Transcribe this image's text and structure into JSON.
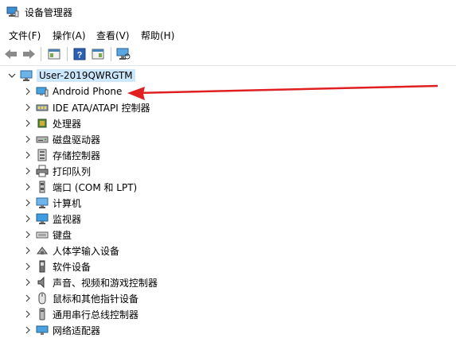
{
  "window": {
    "title": "设备管理器"
  },
  "menu": [
    "文件(F)",
    "操作(A)",
    "查看(V)",
    "帮助(H)"
  ],
  "toolbar": {
    "buttons": [
      "back-icon",
      "forward-icon",
      "properties-view-icon",
      "help-icon",
      "console-view-icon",
      "scan-hardware-icon"
    ]
  },
  "tree": {
    "root": "User-2019QWRGTM",
    "items": [
      {
        "label": "Android Phone",
        "icon": "android-phone-icon"
      },
      {
        "label": "IDE ATA/ATAPI 控制器",
        "icon": "ide-controller-icon"
      },
      {
        "label": "处理器",
        "icon": "processor-icon"
      },
      {
        "label": "磁盘驱动器",
        "icon": "disk-drive-icon"
      },
      {
        "label": "存储控制器",
        "icon": "storage-controller-icon"
      },
      {
        "label": "打印队列",
        "icon": "printer-icon"
      },
      {
        "label": "端口 (COM 和 LPT)",
        "icon": "port-icon"
      },
      {
        "label": "计算机",
        "icon": "computer-icon"
      },
      {
        "label": "监视器",
        "icon": "monitor-icon"
      },
      {
        "label": "键盘",
        "icon": "keyboard-icon"
      },
      {
        "label": "人体学输入设备",
        "icon": "hid-icon"
      },
      {
        "label": "软件设备",
        "icon": "software-device-icon"
      },
      {
        "label": "声音、视频和游戏控制器",
        "icon": "sound-icon"
      },
      {
        "label": "鼠标和其他指针设备",
        "icon": "mouse-icon"
      },
      {
        "label": "通用串行总线控制器",
        "icon": "usb-icon"
      },
      {
        "label": "网络适配器",
        "icon": "network-adapter-icon"
      }
    ]
  },
  "annotation": {
    "arrow_color": "#e02020"
  }
}
